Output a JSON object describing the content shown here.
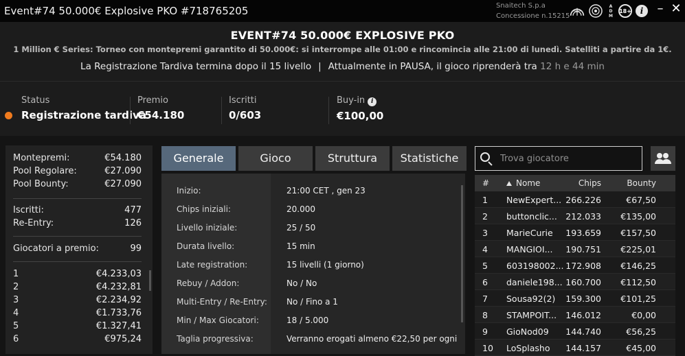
{
  "window": {
    "title": "Event#74 50.000€ Explosive PKO #718765205",
    "license_line1": "Snaitech S.p.a",
    "license_line2": "Concessione n.15215",
    "icon_18": "18+",
    "icon_info": "i",
    "icon_adm": "ADM",
    "minimize": "–",
    "close": "✕"
  },
  "header": {
    "title": "EVENT#74 50.000€ EXPLOSIVE PKO",
    "subtitle": "1 Million € Series: Torneo con montepremi garantito di 50.000€: si interrompe alle 01:00 e rincomincia alle 21:00 di lunedì. Satelliti a partire da 1€.",
    "late_reg": "La Registrazione Tardiva termina dopo il 15 livello",
    "separator": "|",
    "pause_text": "Attualmente in PAUSA, il gioco riprenderà tra",
    "pause_time": "12 h e 44 min"
  },
  "stats": {
    "status_label": "Status",
    "status_value": "Registrazione tardiva",
    "status_color": "#f07b1e",
    "prize_label": "Premio",
    "prize_value": "€54.180",
    "entrants_label": "Iscritti",
    "entrants_value": "0/603",
    "buyin_label": "Buy-in",
    "buyin_value": "€100,00"
  },
  "left_panel": {
    "prize_pool": [
      {
        "k": "Montepremi:",
        "v": "€54.180"
      },
      {
        "k": "Pool Regolare:",
        "v": "€27.090"
      },
      {
        "k": "Pool Bounty:",
        "v": "€27.090"
      }
    ],
    "entries": [
      {
        "k": "Iscritti:",
        "v": "477"
      },
      {
        "k": "Re-Entry:",
        "v": "126"
      }
    ],
    "paid": {
      "k": "Giocatori a premio:",
      "v": "99"
    },
    "payouts": [
      {
        "k": "1",
        "v": "€4.233,03"
      },
      {
        "k": "2",
        "v": "€4.232,81"
      },
      {
        "k": "3",
        "v": "€2.234,92"
      },
      {
        "k": "4",
        "v": "€1.733,76"
      },
      {
        "k": "5",
        "v": "€1.327,41"
      },
      {
        "k": "6",
        "v": "€975,24"
      }
    ]
  },
  "tabs": [
    "Generale",
    "Gioco",
    "Struttura",
    "Statistiche"
  ],
  "active_tab": 0,
  "general": [
    {
      "k": "Inizio:",
      "v": "21:00 CET , gen 23"
    },
    {
      "k": "Chips iniziali:",
      "v": "20.000"
    },
    {
      "k": "Livello iniziale:",
      "v": "25 / 50"
    },
    {
      "k": "Durata livello:",
      "v": "15 min"
    },
    {
      "k": "Late registration:",
      "v": "15 livelli (1 giorno)"
    },
    {
      "k": "Rebuy / Addon:",
      "v": "No / No"
    },
    {
      "k": "Multi-Entry / Re-Entry:",
      "v": "No / Fino a 1"
    },
    {
      "k": "Min / Max Giocatori:",
      "v": "18 / 5.000"
    },
    {
      "k": "Taglia progressiva:",
      "v": "Verranno erogati almeno €22,50 per ogni"
    }
  ],
  "search": {
    "placeholder": "Trova giocatore"
  },
  "players_table": {
    "headers": {
      "rank": "#",
      "name": "Nome",
      "chips": "Chips",
      "bounty": "Bounty"
    },
    "rows": [
      {
        "rank": "1",
        "name": "NewExpert...",
        "chips": "266.226",
        "bounty": "€67,50"
      },
      {
        "rank": "2",
        "name": "buttonclic...",
        "chips": "212.033",
        "bounty": "€135,00"
      },
      {
        "rank": "3",
        "name": "MarieCurie",
        "chips": "193.659",
        "bounty": "€157,50"
      },
      {
        "rank": "4",
        "name": "MANGIOI...",
        "chips": "190.751",
        "bounty": "€225,01"
      },
      {
        "rank": "5",
        "name": "603198002...",
        "chips": "172.908",
        "bounty": "€146,25"
      },
      {
        "rank": "6",
        "name": "daniele198...",
        "chips": "160.700",
        "bounty": "€112,50"
      },
      {
        "rank": "7",
        "name": "Sousa92(2)",
        "chips": "159.300",
        "bounty": "€101,25"
      },
      {
        "rank": "8",
        "name": "STAMPOIT...",
        "chips": "146.012",
        "bounty": "€0,00"
      },
      {
        "rank": "9",
        "name": "GioNod09",
        "chips": "144.740",
        "bounty": "€56,25"
      },
      {
        "rank": "10",
        "name": "LoSplasho",
        "chips": "144.157",
        "bounty": "€45,00"
      }
    ]
  }
}
